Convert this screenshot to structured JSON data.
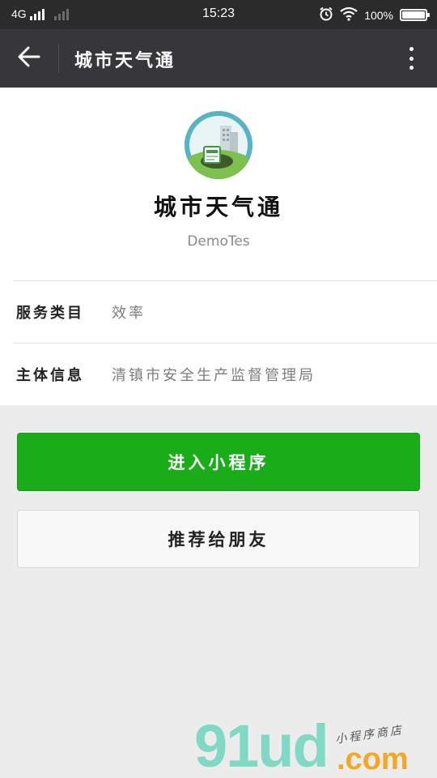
{
  "status_bar": {
    "network": "4G",
    "time": "15:23",
    "battery": "100%",
    "battery_level": 1.0
  },
  "title_bar": {
    "title": "城市天气通",
    "back_icon": "arrow-left-icon",
    "more_icon": "more-vertical-icon"
  },
  "profile": {
    "app_name": "城市天气通",
    "developer": "DemoTes",
    "avatar_icon": "city-weather-avatar"
  },
  "info": {
    "rows": [
      {
        "label": "服务类目",
        "value": "效率"
      },
      {
        "label": "主体信息",
        "value": "清镇市安全生产监督管理局"
      }
    ]
  },
  "actions": {
    "enter_label": "进入小程序",
    "share_label": "推荐给朋友"
  },
  "colors": {
    "primary": "#1aad19",
    "title_bar": "#37373a",
    "status_bar": "#2b2b2c",
    "background": "#ececec"
  },
  "watermark": {
    "brand": "91ud",
    "domain": ".com",
    "tagline": "小程序商店"
  }
}
